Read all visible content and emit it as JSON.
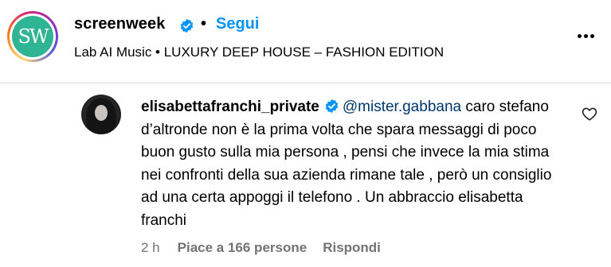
{
  "post_header": {
    "account": "screenweek",
    "avatar_monogram": "SW",
    "separator": "•",
    "follow_label": "Segui",
    "subtitle": "Lab AI Music • LUXURY DEEP HOUSE – FASHION EDITION",
    "more_icon": "more-horizontal-icon"
  },
  "comment": {
    "author": "elisabettafranchi_private",
    "mention": "@mister.gabbana",
    "text": "caro stefano d’altronde non è la prima volta che spara messaggi di poco buon gusto sulla mia persona , pensi che invece la mia stima nei confronti della sua azienda rimane tale , però un consiglio ad una certa appoggi il telefono . Un abbraccio elisabetta franchi",
    "time": "2 h",
    "likes": "Piace a 166 persone",
    "reply_label": "Rispondi"
  },
  "colors": {
    "verified_blue": "#0095f6",
    "link_blue": "#0095f6",
    "mention_blue": "#00376b",
    "meta_gray": "#737373",
    "avatar_green": "#2fb593"
  }
}
